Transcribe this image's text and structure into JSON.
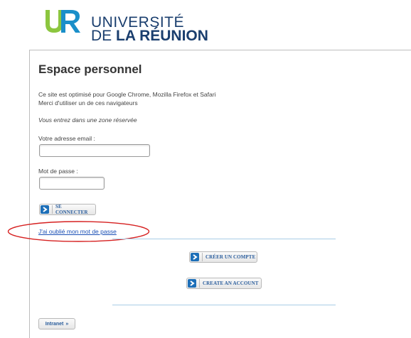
{
  "header": {
    "logo_line1": "UNIVERSITÉ",
    "logo_line2_prefix": "DE ",
    "logo_line2_bold": "LA RÉUNION"
  },
  "main": {
    "title": "Espace personnel",
    "browser_notice_1": "Ce site est optimisé pour Google Chrome, Mozilla Firefox et Safari",
    "browser_notice_2": "Merci d'utiliser un de ces navigateurs",
    "restricted_notice": "Vous entrez dans une zone réservée",
    "email_label": "Votre adresse email :",
    "email_value": "",
    "password_label": "Mot de passe :",
    "password_value": "",
    "login_button": "SE CONNECTER",
    "forgot_link": "J'ai oublié mon mot de passe",
    "create_account_fr": "CRÉER UN COMPTE",
    "create_account_en": "CREATE AN ACCOUNT",
    "intranet_button": "Intranet",
    "intranet_arrows": "»"
  },
  "colors": {
    "brand_blue": "#1a3e6e",
    "button_icon": "#1d6fb8",
    "link": "#1a4fb5",
    "highlight_oval": "#d62020"
  },
  "icons": [
    "chevron-right-icon",
    "double-chevron-right-icon"
  ]
}
